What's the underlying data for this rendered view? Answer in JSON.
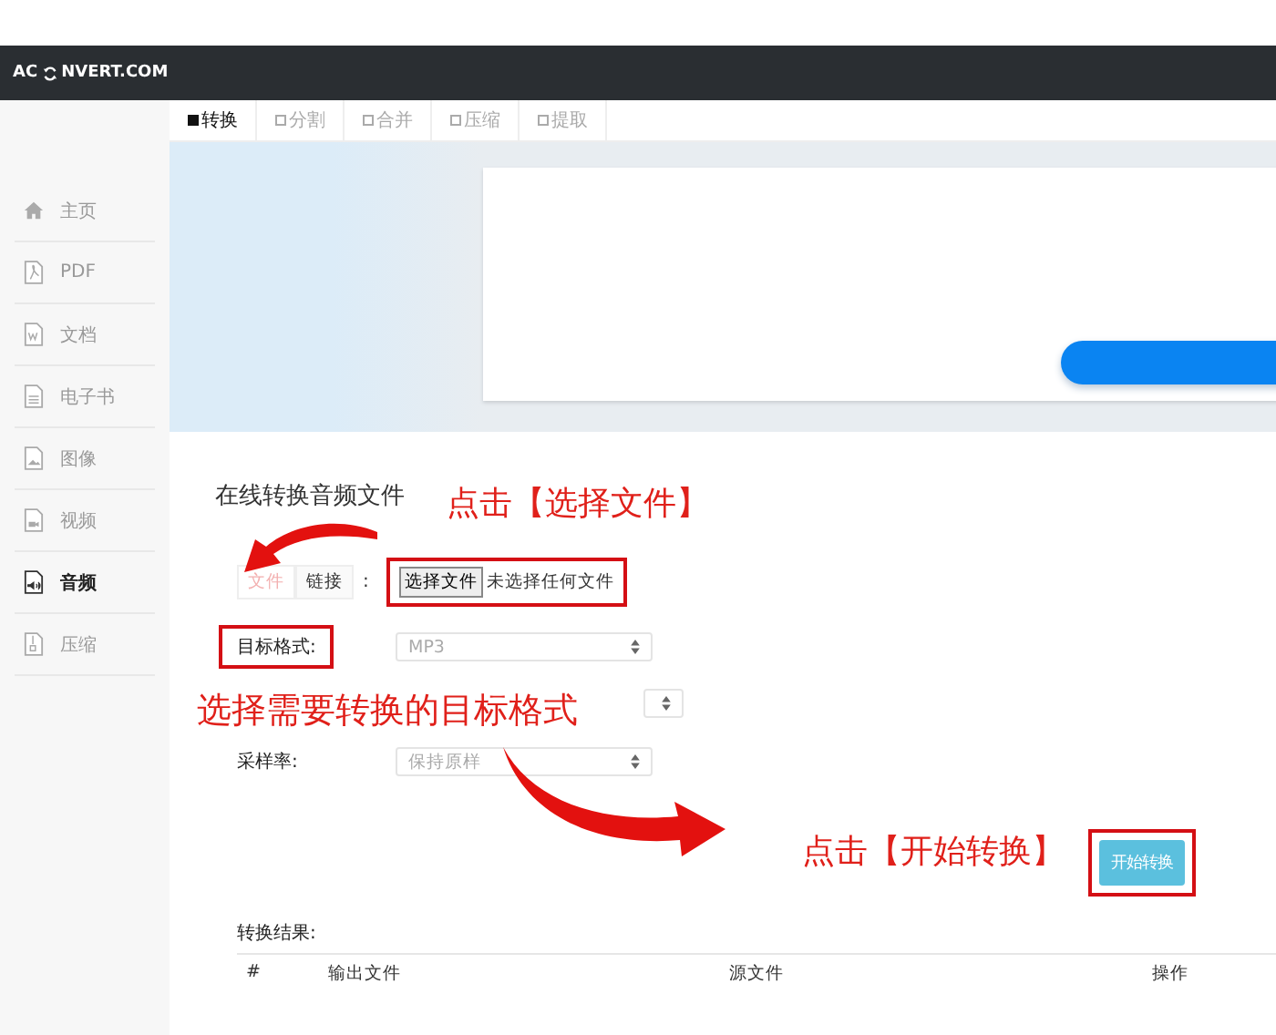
{
  "header": {
    "logo_start": "AC",
    "logo_end": "NVERT.COM"
  },
  "tabs": [
    {
      "label": "转换",
      "selected": true
    },
    {
      "label": "分割",
      "selected": false
    },
    {
      "label": "合并",
      "selected": false
    },
    {
      "label": "压缩",
      "selected": false
    },
    {
      "label": "提取",
      "selected": false
    }
  ],
  "sidebar": {
    "items": [
      {
        "label": "主页",
        "kind": "home",
        "selected": false
      },
      {
        "label": "PDF",
        "kind": "pdf",
        "selected": false
      },
      {
        "label": "文档",
        "kind": "word",
        "selected": false
      },
      {
        "label": "电子书",
        "kind": "book",
        "selected": false
      },
      {
        "label": "图像",
        "kind": "image",
        "selected": false
      },
      {
        "label": "视频",
        "kind": "video",
        "selected": false
      },
      {
        "label": "音频",
        "kind": "audio",
        "selected": true
      },
      {
        "label": "压缩",
        "kind": "zip",
        "selected": false
      }
    ]
  },
  "form": {
    "title": "在线转换音频文件",
    "source_toggle": [
      {
        "label": "文件",
        "selected": true
      },
      {
        "label": "链接",
        "selected": false
      }
    ],
    "toggle_suffix": ":",
    "file_button": "选择文件",
    "file_status": "未选择任何文件",
    "file_highlighted": true,
    "fields": [
      {
        "label": "目标格式:",
        "value": "MP3",
        "highlighted": true
      },
      {
        "label": "采样率:",
        "value": "保持原样",
        "highlighted": false
      }
    ],
    "start_button": "开始转换",
    "start_highlighted": true
  },
  "results": {
    "title": "转换结果:",
    "columns": [
      "#",
      "输出文件",
      "源文件",
      "操作"
    ]
  },
  "callouts": [
    {
      "text": "点击【选择文件】"
    },
    {
      "text": "选择需要转换的目标格式"
    },
    {
      "text": "点击【开始转换】"
    }
  ]
}
